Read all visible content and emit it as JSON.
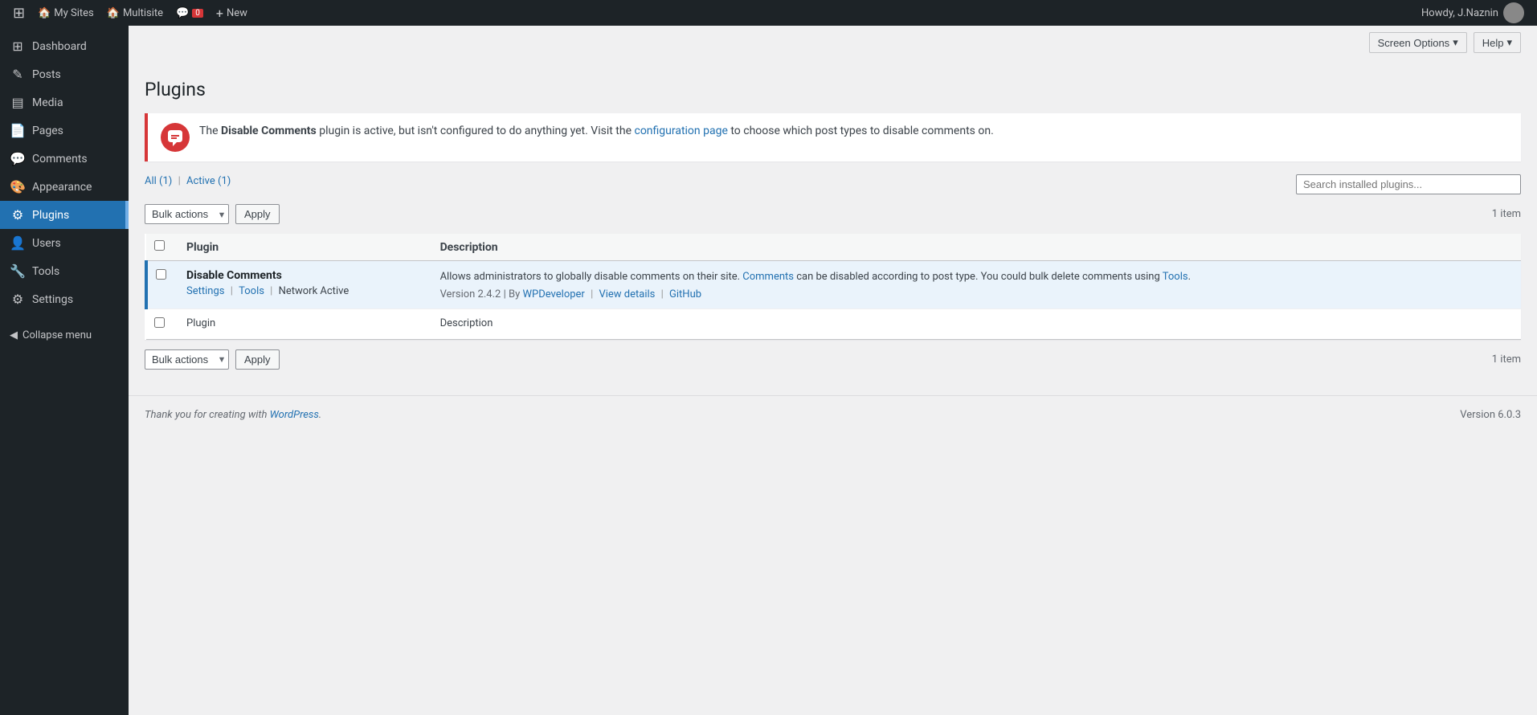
{
  "adminbar": {
    "logo_label": "WordPress",
    "my_sites_label": "My Sites",
    "multisite_label": "Multisite",
    "comments_label": "0",
    "new_label": "New",
    "howdy_label": "Howdy, J.Naznin",
    "screen_options_label": "Screen Options",
    "help_label": "Help"
  },
  "sidebar": {
    "items": [
      {
        "id": "dashboard",
        "label": "Dashboard",
        "icon": "⊞"
      },
      {
        "id": "posts",
        "label": "Posts",
        "icon": "✎"
      },
      {
        "id": "media",
        "label": "Media",
        "icon": "▤"
      },
      {
        "id": "pages",
        "label": "Pages",
        "icon": "📄"
      },
      {
        "id": "comments",
        "label": "Comments",
        "icon": "💬"
      },
      {
        "id": "appearance",
        "label": "Appearance",
        "icon": "🎨"
      },
      {
        "id": "plugins",
        "label": "Plugins",
        "icon": "⚙"
      },
      {
        "id": "users",
        "label": "Users",
        "icon": "👤"
      },
      {
        "id": "tools",
        "label": "Tools",
        "icon": "🔧"
      },
      {
        "id": "settings",
        "label": "Settings",
        "icon": "⚙"
      }
    ],
    "collapse_label": "Collapse menu"
  },
  "page": {
    "title": "Plugins",
    "notice": {
      "plugin_name": "Disable Comments",
      "message_before": "The ",
      "message_after": " plugin is active, but isn't configured to do anything yet. Visit the ",
      "link_text": "configuration page",
      "message_end": " to choose which post types to disable comments on."
    },
    "filter": {
      "all_label": "All",
      "all_count": "(1)",
      "active_label": "Active",
      "active_count": "(1)"
    },
    "search_placeholder": "Search installed plugins...",
    "bulk_actions_label": "Bulk actions",
    "apply_label": "Apply",
    "item_count_top": "1 item",
    "item_count_bottom": "1 item",
    "table": {
      "col_plugin": "Plugin",
      "col_description": "Description",
      "plugins": [
        {
          "name": "Disable Comments",
          "action_settings": "Settings",
          "action_tools": "Tools",
          "action_network": "Network Active",
          "description": "Allows administrators to globally disable comments on their site. Comments can be disabled according to post type. You could bulk delete comments using Tools.",
          "version_label": "Version 2.4.2",
          "by_label": "By",
          "author": "WPDeveloper",
          "view_details": "View details",
          "github": "GitHub",
          "active": true
        }
      ]
    }
  },
  "footer": {
    "thank_you": "Thank you for creating with ",
    "wordpress_label": "WordPress",
    "version": "Version 6.0.3"
  }
}
